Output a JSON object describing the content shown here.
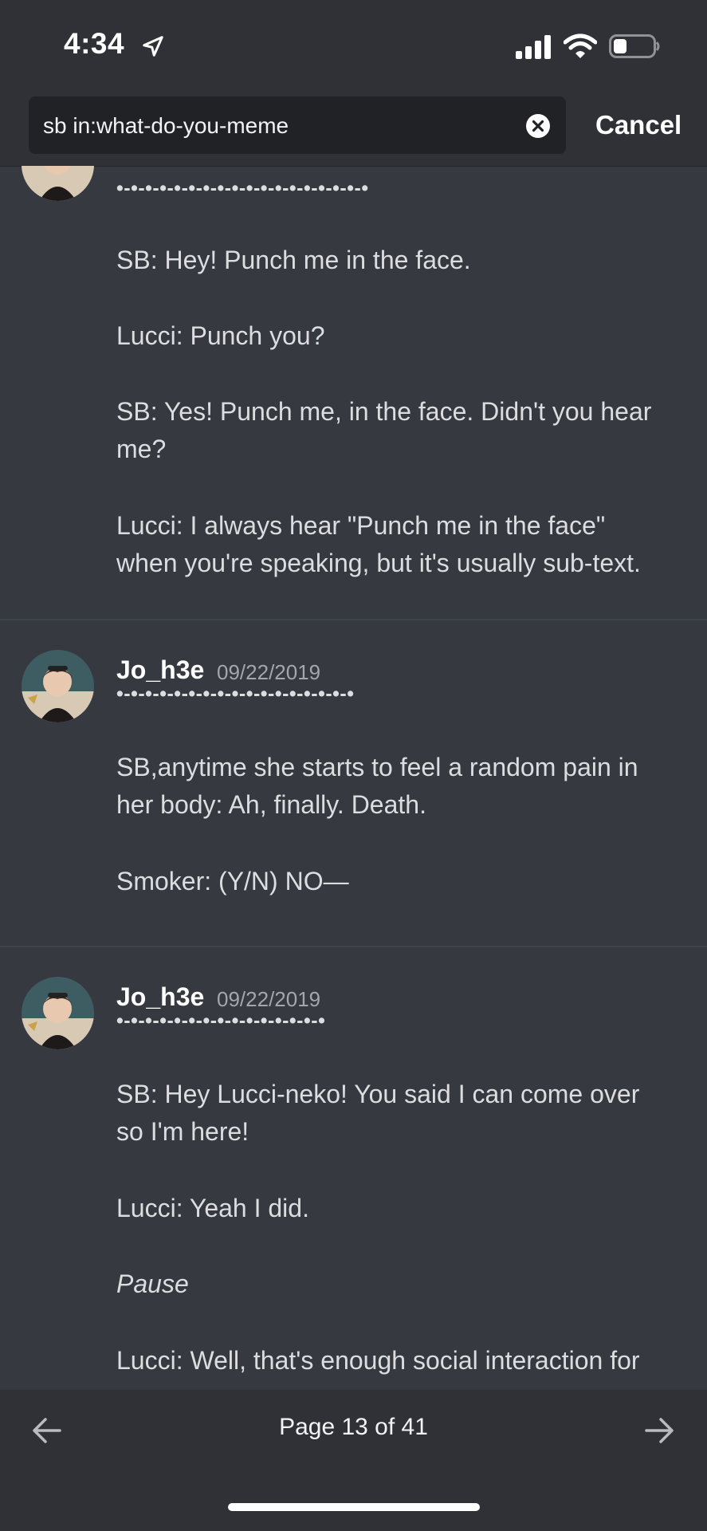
{
  "status_bar": {
    "time": "4:34",
    "location_icon": "location-arrow-icon",
    "signal_icon": "cellular-signal-icon",
    "wifi_icon": "wifi-icon",
    "battery_icon": "battery-icon"
  },
  "search": {
    "query": "sb in:what-do-you-meme",
    "clear_icon": "clear-search-icon",
    "cancel_label": "Cancel"
  },
  "messages": [
    {
      "author": "",
      "date": "",
      "separator": "•-•-•-•-•-•-•-•-•-•-•-•-•-•-•-•-•-•",
      "lines": [
        "SB: Hey! Punch me in the face.",
        "Lucci: Punch you?",
        "SB: Yes! Punch me, in the face. Didn't you hear",
        "me?",
        "Lucci: I always hear \"Punch me in the face\"",
        "when you're speaking, but it's usually sub-text."
      ]
    },
    {
      "author": "Jo_h3e",
      "date": "09/22/2019",
      "separator": "•-•-•-•-•-•-•-•-•-•-•-•-•-•-•-•-•",
      "lines": [
        "SB,anytime she starts to feel a random pain in",
        "her body: Ah, finally. Death.",
        "Smoker: (Y/N) NO—"
      ]
    },
    {
      "author": "Jo_h3e",
      "date": "09/22/2019",
      "separator": "•-•-•-•-•-•-•-•-•-•-•-•-•-•-•",
      "lines": [
        "SB: Hey Lucci-neko! You said I can come over",
        "so I'm here!",
        "Lucci: Yeah I did.",
        "Pause",
        "Lucci: Well, that's enough social interaction for"
      ]
    }
  ],
  "pagination": {
    "page_label": "Page 13 of 41",
    "prev_icon": "arrow-left-icon",
    "next_icon": "arrow-right-icon"
  },
  "colors": {
    "background": "#36393f",
    "header": "#303136",
    "search_field": "#202225",
    "text": "#dcddde",
    "muted": "#a3a6aa"
  }
}
